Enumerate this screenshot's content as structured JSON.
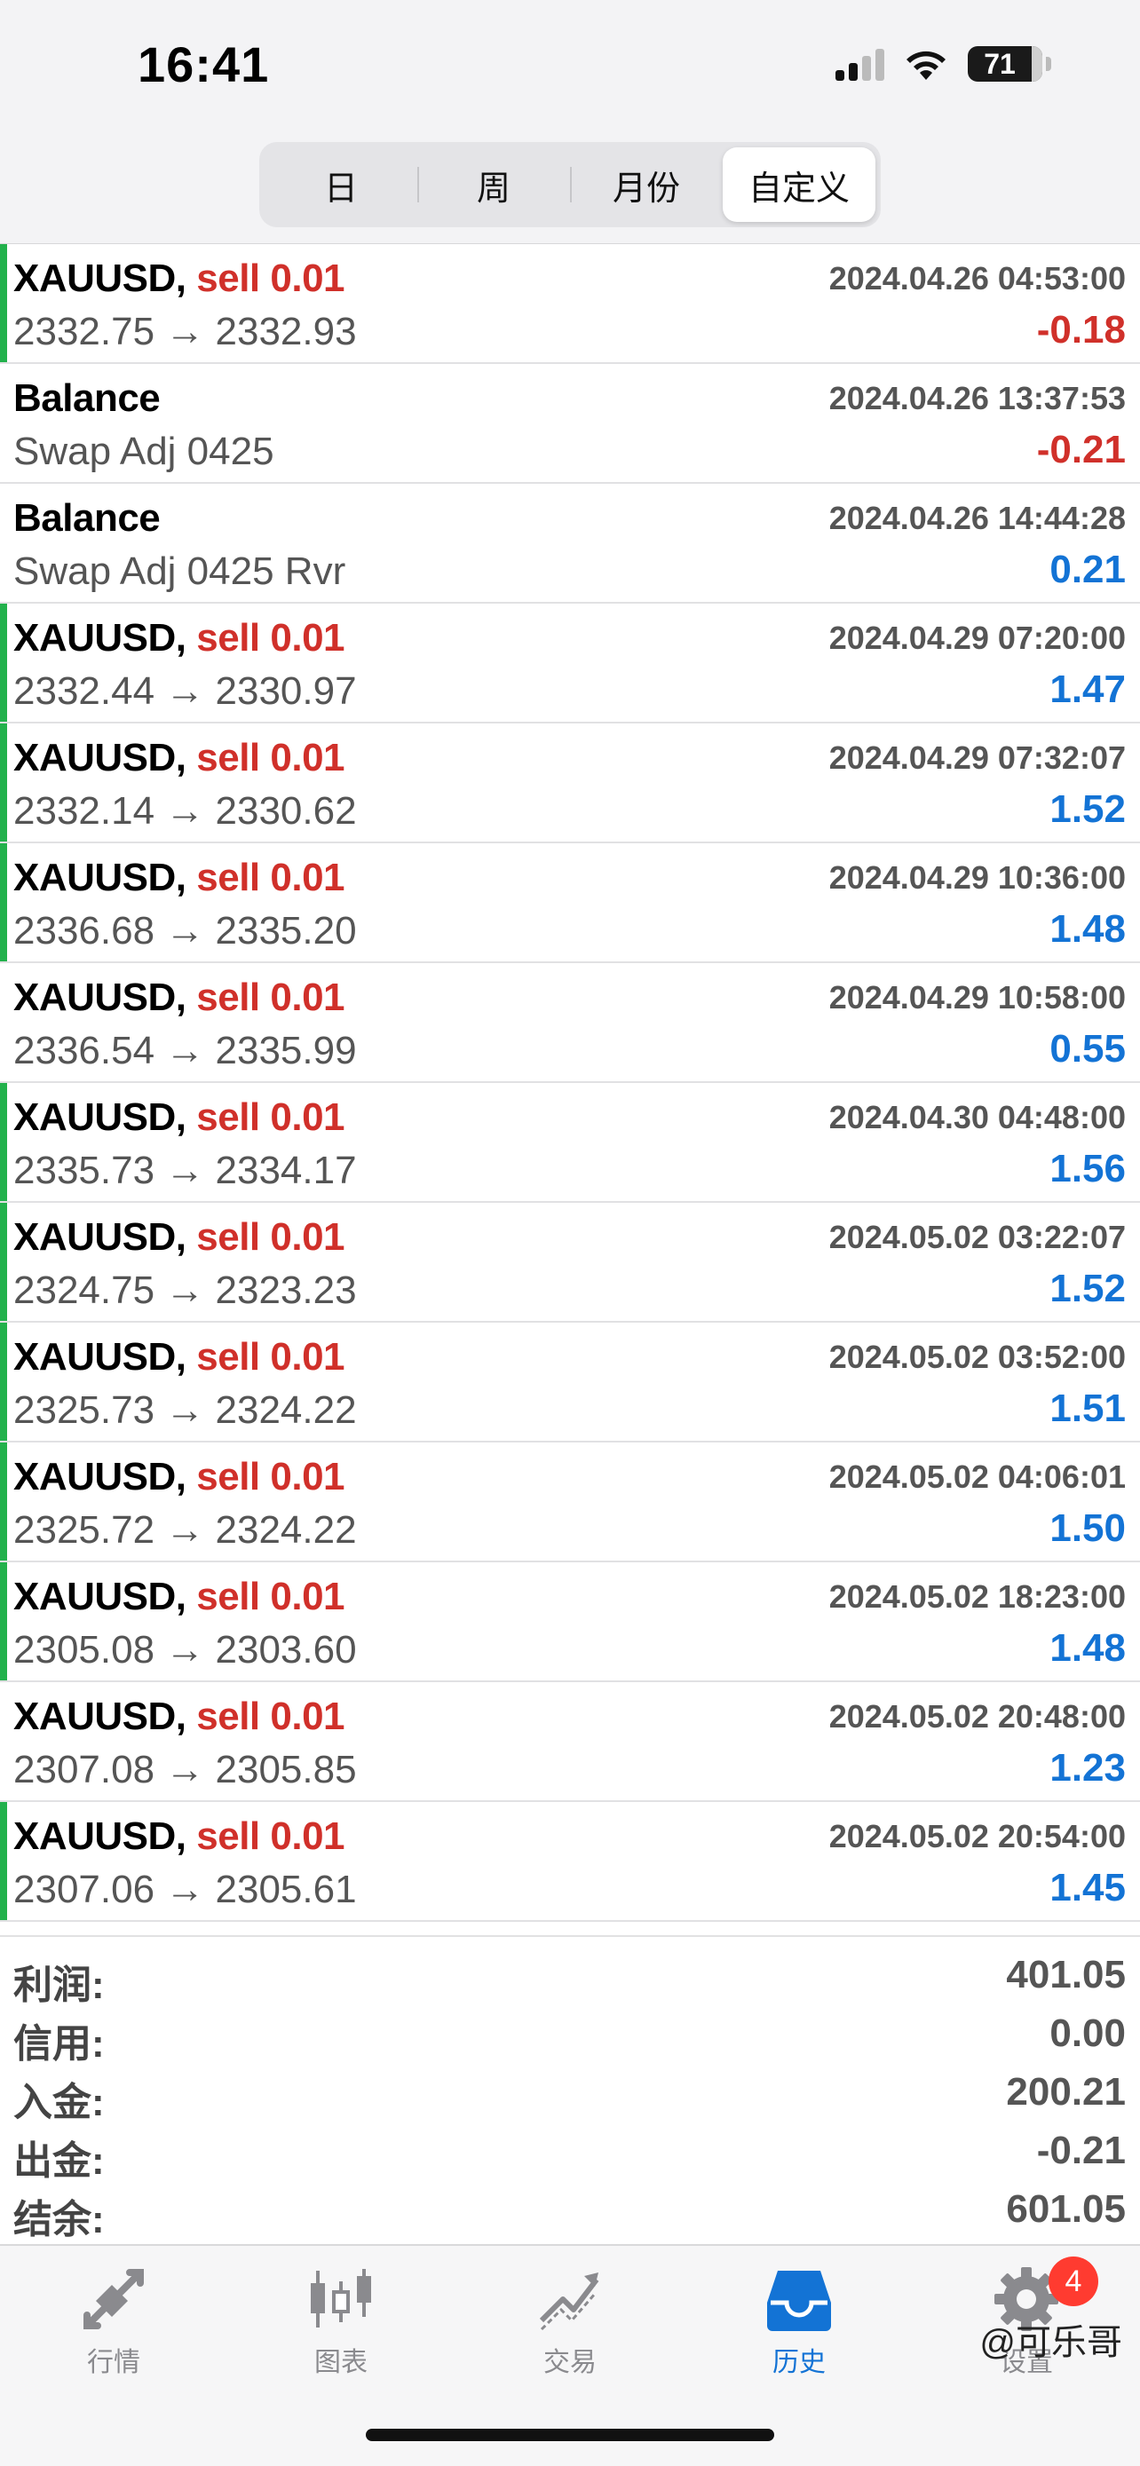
{
  "status_bar": {
    "time": "16:41",
    "battery": "71"
  },
  "segments": [
    {
      "label": "日",
      "active": false
    },
    {
      "label": "周",
      "active": false
    },
    {
      "label": "月份",
      "active": false
    },
    {
      "label": "自定义",
      "active": true
    }
  ],
  "deals": [
    {
      "symbol": "XAUUSD,",
      "trade": "sell 0.01",
      "time": "2024.04.26 04:53:00",
      "detail": "2332.75 → 2332.93",
      "profit": "-0.18",
      "positive": false,
      "win": true
    },
    {
      "symbol": "Balance",
      "trade": "",
      "time": "2024.04.26 13:37:53",
      "detail": "Swap Adj 0425",
      "profit": "-0.21",
      "positive": false,
      "win": false
    },
    {
      "symbol": "Balance",
      "trade": "",
      "time": "2024.04.26 14:44:28",
      "detail": "Swap Adj 0425 Rvr",
      "profit": "0.21",
      "positive": true,
      "win": false
    },
    {
      "symbol": "XAUUSD,",
      "trade": "sell 0.01",
      "time": "2024.04.29 07:20:00",
      "detail": "2332.44 → 2330.97",
      "profit": "1.47",
      "positive": true,
      "win": true
    },
    {
      "symbol": "XAUUSD,",
      "trade": "sell 0.01",
      "time": "2024.04.29 07:32:07",
      "detail": "2332.14 → 2330.62",
      "profit": "1.52",
      "positive": true,
      "win": true
    },
    {
      "symbol": "XAUUSD,",
      "trade": "sell 0.01",
      "time": "2024.04.29 10:36:00",
      "detail": "2336.68 → 2335.20",
      "profit": "1.48",
      "positive": true,
      "win": true
    },
    {
      "symbol": "XAUUSD,",
      "trade": "sell 0.01",
      "time": "2024.04.29 10:58:00",
      "detail": "2336.54 → 2335.99",
      "profit": "0.55",
      "positive": true,
      "win": false
    },
    {
      "symbol": "XAUUSD,",
      "trade": "sell 0.01",
      "time": "2024.04.30 04:48:00",
      "detail": "2335.73 → 2334.17",
      "profit": "1.56",
      "positive": true,
      "win": true
    },
    {
      "symbol": "XAUUSD,",
      "trade": "sell 0.01",
      "time": "2024.05.02 03:22:07",
      "detail": "2324.75 → 2323.23",
      "profit": "1.52",
      "positive": true,
      "win": true
    },
    {
      "symbol": "XAUUSD,",
      "trade": "sell 0.01",
      "time": "2024.05.02 03:52:00",
      "detail": "2325.73 → 2324.22",
      "profit": "1.51",
      "positive": true,
      "win": true
    },
    {
      "symbol": "XAUUSD,",
      "trade": "sell 0.01",
      "time": "2024.05.02 04:06:01",
      "detail": "2325.72 → 2324.22",
      "profit": "1.50",
      "positive": true,
      "win": true
    },
    {
      "symbol": "XAUUSD,",
      "trade": "sell 0.01",
      "time": "2024.05.02 18:23:00",
      "detail": "2305.08 → 2303.60",
      "profit": "1.48",
      "positive": true,
      "win": true
    },
    {
      "symbol": "XAUUSD,",
      "trade": "sell 0.01",
      "time": "2024.05.02 20:48:00",
      "detail": "2307.08 → 2305.85",
      "profit": "1.23",
      "positive": true,
      "win": false
    },
    {
      "symbol": "XAUUSD,",
      "trade": "sell 0.01",
      "time": "2024.05.02 20:54:00",
      "detail": "2307.06 → 2305.61",
      "profit": "1.45",
      "positive": true,
      "win": true
    }
  ],
  "summary": [
    {
      "label": "利润:",
      "value": "401.05"
    },
    {
      "label": "信用:",
      "value": "0.00"
    },
    {
      "label": "入金:",
      "value": "200.21"
    },
    {
      "label": "出金:",
      "value": "-0.21"
    },
    {
      "label": "结余:",
      "value": "601.05"
    }
  ],
  "tabs": [
    {
      "label": "行情",
      "icon": "quotes-arrows-icon",
      "active": false
    },
    {
      "label": "图表",
      "icon": "candlestick-chart-icon",
      "active": false
    },
    {
      "label": "交易",
      "icon": "trade-trend-icon",
      "active": false
    },
    {
      "label": "历史",
      "icon": "history-inbox-icon",
      "active": true
    },
    {
      "label": "设置",
      "icon": "gear-icon",
      "active": false,
      "badge": "4"
    }
  ],
  "watermark": "@可乐哥",
  "colors": {
    "accent": "#1373d5",
    "negative": "#d0302a",
    "win_marker": "#22b14c",
    "badge": "#ff3b30"
  }
}
